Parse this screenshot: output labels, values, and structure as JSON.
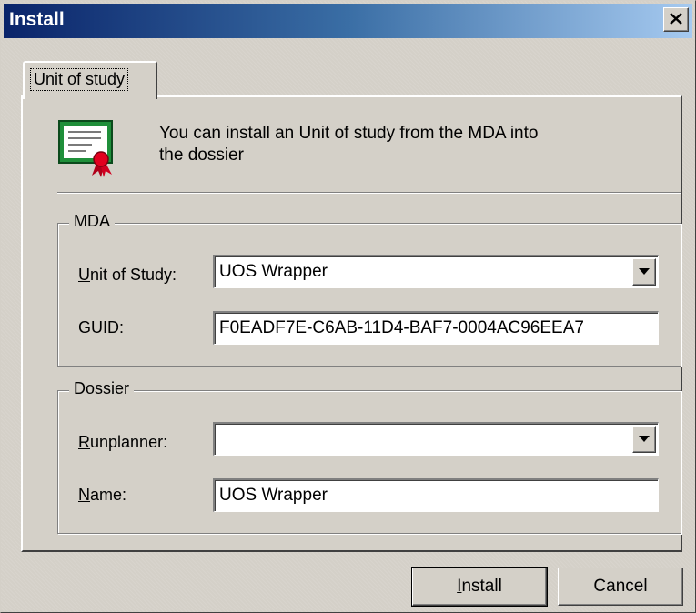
{
  "window": {
    "title": "Install",
    "close_glyph": "×"
  },
  "tabs": [
    {
      "label": "Unit of study",
      "selected": true
    }
  ],
  "intro": {
    "icon": "certificate-icon",
    "text_line1": "You can install an Unit of study from the MDA into",
    "text_line2": "the dossier"
  },
  "mda": {
    "title": "MDA",
    "unit_label_key": "U",
    "unit_label_rest": "nit of Study:",
    "unit_value": "UOS Wrapper",
    "guid_label": "GUID:",
    "guid_value": "F0EADF7E-C6AB-11D4-BAF7-0004AC96EEA7"
  },
  "dossier": {
    "title": "Dossier",
    "runplanner_label_key": "R",
    "runplanner_label_rest": "unplanner:",
    "runplanner_value": "",
    "name_label_key": "N",
    "name_label_rest": "ame:",
    "name_value": "UOS Wrapper"
  },
  "buttons": {
    "install_key": "I",
    "install_rest": "nstall",
    "cancel": "Cancel"
  },
  "colors": {
    "titlebar_start": "#0a246a",
    "titlebar_end": "#a6caf0",
    "face": "#d4d0c8"
  }
}
